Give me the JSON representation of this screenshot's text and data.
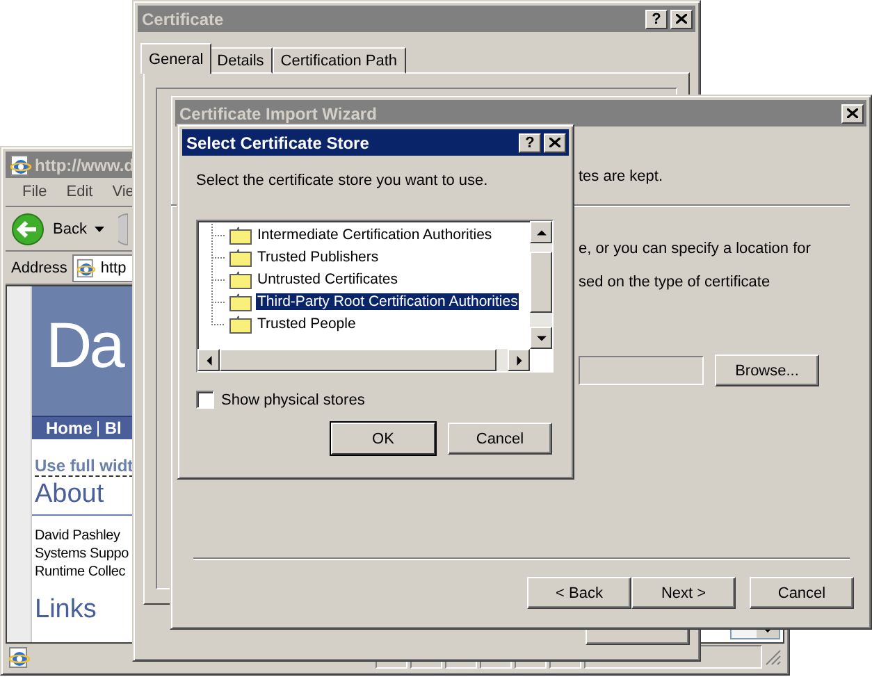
{
  "browser_window": {
    "title": "http://www.d",
    "active": false,
    "menu": [
      "File",
      "Edit",
      "Vie"
    ],
    "back_label": "Back",
    "address_label": "Address",
    "address_value": "http",
    "banner_text": "Da",
    "nav": [
      "Home",
      "Bl"
    ],
    "full_width_link": "Use full widt",
    "about_heading": "About",
    "about_lines": [
      "David Pashley",
      "Systems Suppo",
      "Runtime Collec"
    ],
    "links_heading": "Links"
  },
  "certificate_window": {
    "title": "Certificate",
    "active": false,
    "help_button": "?",
    "tabs": [
      {
        "label": "General",
        "selected": true
      },
      {
        "label": "Details",
        "selected": false
      },
      {
        "label": "Certification Path",
        "selected": false
      }
    ]
  },
  "wizard": {
    "title": "Certificate Import Wizard",
    "active": false,
    "text_1": "tes are kept.",
    "text_2": "e, or you can specify a location for",
    "text_3": "sed on the type of certificate",
    "browse_button": "Browse...",
    "buttons": [
      "< Back",
      "Next >",
      "Cancel"
    ]
  },
  "store_dialog": {
    "title": "Select Certificate Store",
    "active": true,
    "help_button": "?",
    "prompt": "Select the certificate store you want to use.",
    "stores": [
      {
        "label": "Intermediate Certification Authorities",
        "selected": false
      },
      {
        "label": "Trusted Publishers",
        "selected": false
      },
      {
        "label": "Untrusted Certificates",
        "selected": false
      },
      {
        "label": "Third-Party Root Certification Authorities",
        "selected": true
      },
      {
        "label": "Trusted People",
        "selected": false
      }
    ],
    "show_physical": {
      "label": "Show physical stores",
      "checked": false
    },
    "buttons": [
      "OK",
      "Cancel"
    ]
  }
}
